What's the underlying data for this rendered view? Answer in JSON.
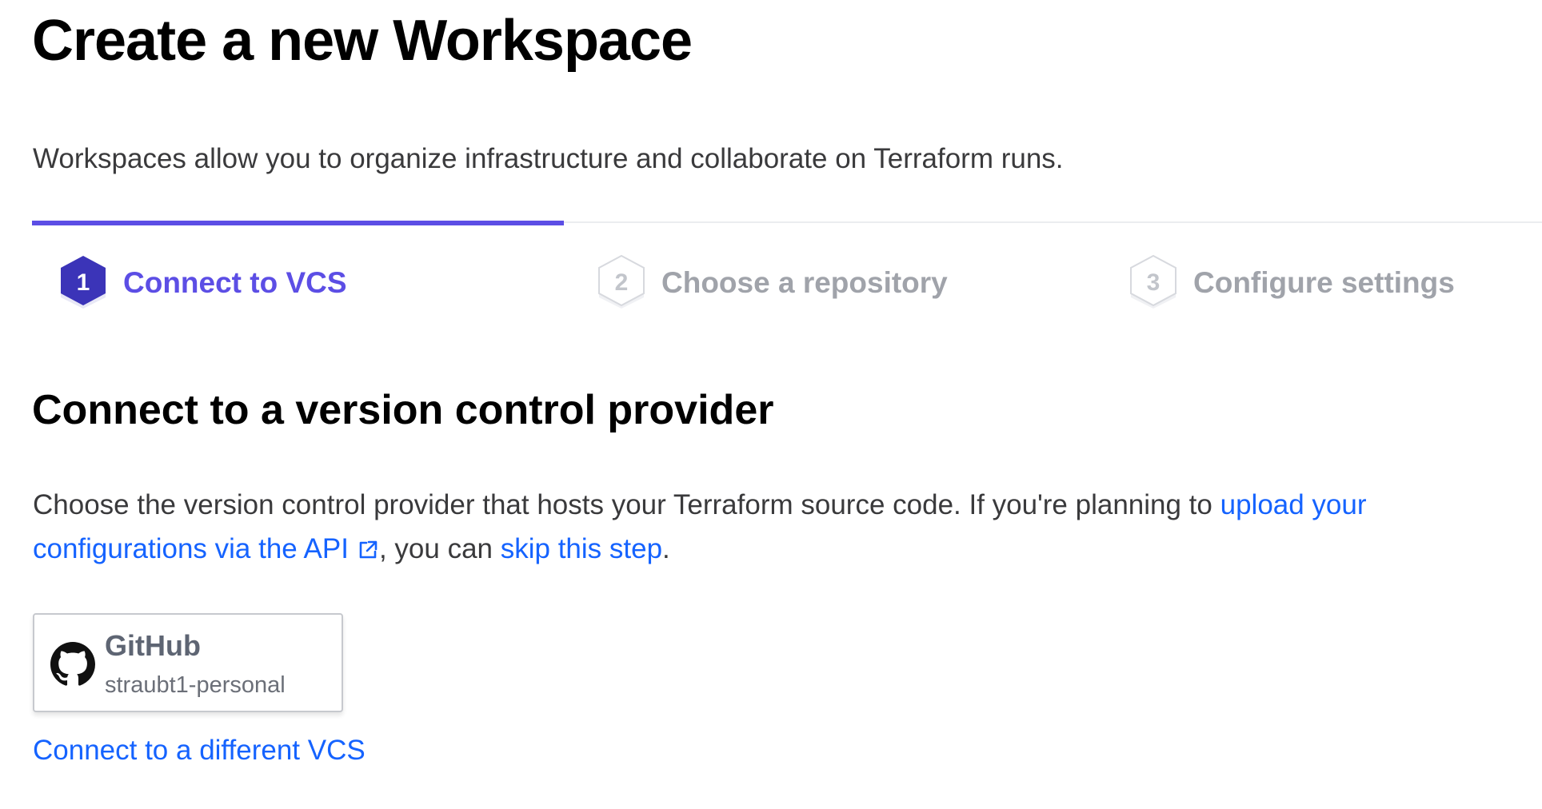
{
  "page": {
    "title": "Create a new Workspace",
    "subtitle": "Workspaces allow you to organize infrastructure and collaborate on Terraform runs."
  },
  "stepper": {
    "progress_fraction": 0.333,
    "accent_color": "#5c4ee5",
    "steps": [
      {
        "number": "1",
        "label": "Connect to VCS",
        "state": "active"
      },
      {
        "number": "2",
        "label": "Choose a repository",
        "state": "inactive"
      },
      {
        "number": "3",
        "label": "Configure settings",
        "state": "inactive"
      }
    ]
  },
  "section": {
    "title": "Connect to a version control provider",
    "description_before": "Choose the version control provider that hosts your Terraform source code. If you're planning to ",
    "api_link": "upload your configurations via the API",
    "description_middle": ", you can ",
    "skip_link": "skip this step",
    "description_after": ".",
    "link_color": "#1563ff"
  },
  "vcs_providers": [
    {
      "name": "GitHub",
      "account": "straubt1-personal",
      "icon": "github-icon"
    }
  ],
  "connect_different_link": "Connect to a different VCS"
}
